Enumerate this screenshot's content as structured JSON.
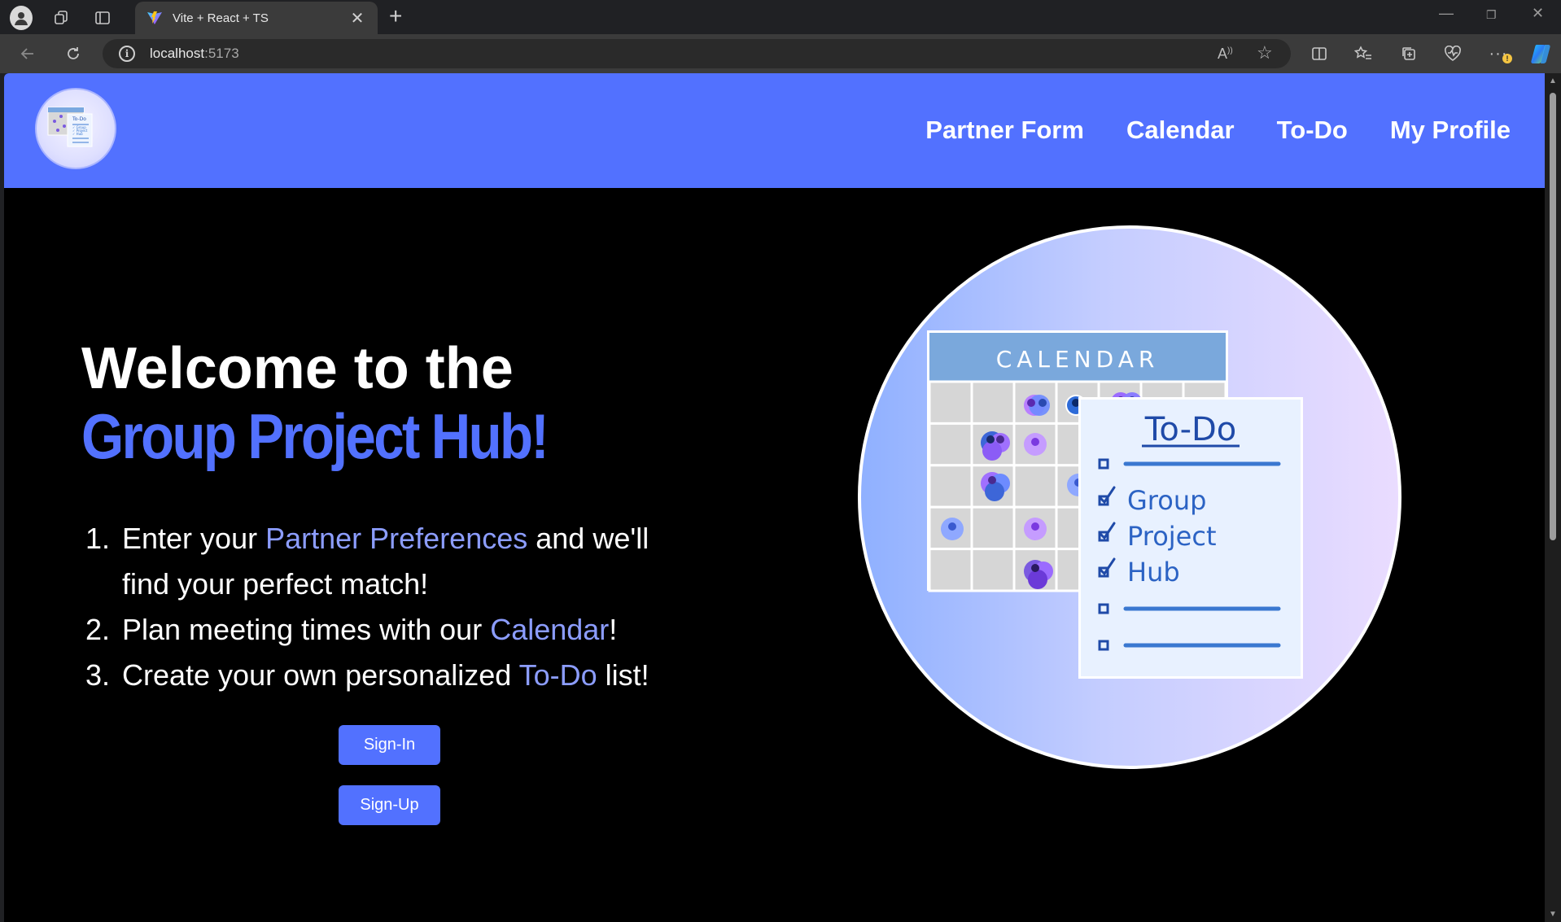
{
  "browser": {
    "tab_title": "Vite + React + TS",
    "url_host": "localhost",
    "url_port": ":5173"
  },
  "nav": {
    "items": [
      "Partner Form",
      "Calendar",
      "To-Do",
      "My Profile"
    ]
  },
  "hero": {
    "title_line1": "Welcome to the",
    "title_line2": "Group Project Hub!",
    "steps": [
      {
        "num": "1.",
        "before": "Enter your ",
        "link": "Partner Preferences",
        "after": " and we'll find your perfect match!"
      },
      {
        "num": "2.",
        "before": "Plan meeting times with our ",
        "link": "Calendar",
        "after": "!"
      },
      {
        "num": "3.",
        "before": "Create your own personalized ",
        "link": "To-Do",
        "after": " list!"
      }
    ],
    "signin_label": "Sign-In",
    "signup_label": "Sign-Up"
  },
  "illustration": {
    "calendar_label": "CALENDAR",
    "todo_title": "To-Do",
    "todo_items": [
      "Group",
      "Project",
      "Hub"
    ]
  },
  "colors": {
    "brand": "#5271ff",
    "link": "#8c9dff"
  }
}
